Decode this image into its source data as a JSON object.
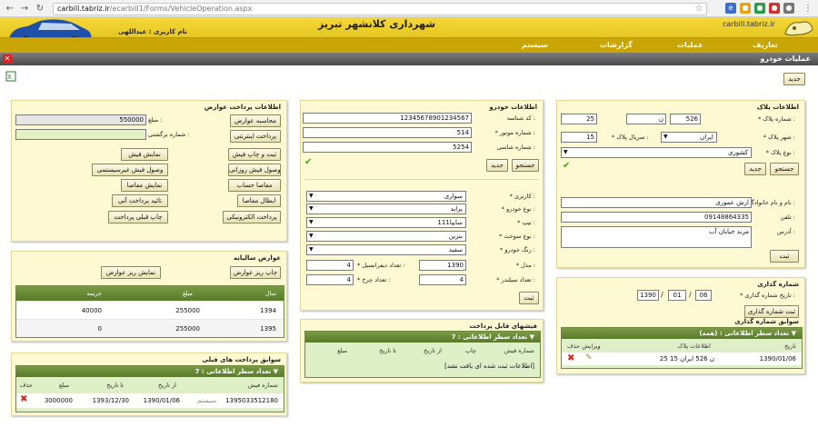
{
  "browser": {
    "host": "carbill.tabriz.ir",
    "path": "/ecarbill1/Forms/VehicleOperation.aspx"
  },
  "header": {
    "title": "شهرداری کلانشهر تبریز",
    "logo_text": "carbill.tabriz.ir",
    "user": "نام کاربری : عبداللهی"
  },
  "menu": {
    "items": [
      "تعاریف",
      "عملیات",
      "گزارشات",
      "سیستم"
    ]
  },
  "page_title": "عملیات خودرو",
  "new_button": "جدید",
  "plate": {
    "title": "اطلاعات پلاک",
    "plate_no_label": "* شماره پلاک :",
    "plate_a": "526",
    "plate_b": "ن",
    "plate_c": "25",
    "city_label": "* شهر پلاک :",
    "city": "ایران",
    "serial_label": "* سریال پلاک :",
    "serial": "15",
    "type_label": "* نوع پلاک :",
    "type": "کشوری",
    "search": "جستجو",
    "new": "جدید",
    "name_label": "* نام و نام خانوادگی :",
    "name": "ارش عموری",
    "phone_label": "تلفن :",
    "phone": "09148864335",
    "address_label": "آدرس :",
    "address": "مرند خیابان آب",
    "save": "ثبت"
  },
  "vehicle": {
    "title": "اطلاعات خودرو",
    "vin_label": "کد شناسه :",
    "vin": "12345678901234567",
    "engine_label": "* شماره موتور :",
    "engine": "514",
    "chassis_label": "شماره شاسی :",
    "chassis": "5254",
    "search": "جستجو",
    "new": "جدید",
    "usage_label": "* کاربری :",
    "usage": "سواری",
    "type_label": "* نوع خودرو :",
    "type": "پراید",
    "system_label": "* تیپ :",
    "system": "111سایپا",
    "fuel_label": "* نوع سوخت :",
    "fuel": "بنزین",
    "color_label": "* رنگ خودرو :",
    "color": "سفید",
    "model_label": "* مدل :",
    "model": "1390",
    "cyl_label": "* تعداد دیفرانسیل :",
    "cyl": "4",
    "seats_label": "* تعداد سیلندر :",
    "seats": "4",
    "wheels_label": "* تعداد چرخ :",
    "wheels": "4",
    "save": "ثبت"
  },
  "tolls": {
    "title": "اطلاعات پرداخت عوارض",
    "amount_label": "مبلغ :",
    "amount": "550000",
    "receipt_label": "شماره برگشتی :",
    "receipt": "",
    "b1": "محاسبه عوارض",
    "b2": "پرداخت اینترنتی",
    "b3": "ثبت و چاپ فیش",
    "b4": "نمایش فیش",
    "b5": "وصول فیش روزانی",
    "b6": "وصول فیش غیرسیستمی",
    "b7": "مفاصا حساب",
    "b8": "نمایش مفاصا",
    "b9": "ابطال مفاصا",
    "b10": "تائید پرداخت آنی",
    "b11": "پرداخت الکترونیکی",
    "b12": "چاپ قبلی پرداخت"
  },
  "annual": {
    "title": "عوارض سالیانه",
    "print": "چاپ ریز عوارض",
    "show": "نمایش ریز عوارض",
    "headers": [
      "سال",
      "مبلغ",
      "جریمه"
    ],
    "rows": [
      [
        "1394",
        "255000",
        "40000"
      ],
      [
        "1395",
        "255000",
        "0"
      ]
    ]
  },
  "receipts_grid": {
    "title": "فیشهای قابل پرداخت",
    "count_label": "تعداد سطر اطلاعاتی :",
    "count": "7",
    "headers": [
      "شماره فیش",
      "چاپ",
      "از تاریخ",
      "تا تاریخ",
      "مبلغ"
    ],
    "empty": "[اطلاعات ثبت شده ای یافت نشد]"
  },
  "history": {
    "title": "سوابق پرداخت های قبلی",
    "count_label": "تعداد سطر اطلاعاتی :",
    "count": "7",
    "headers": [
      "شماره فیش",
      "",
      "از تاریخ",
      "تا تاریخ",
      "مبلغ",
      "حذف"
    ],
    "row": [
      "1395033512180",
      "سیستم",
      "1390/01/06",
      "1393/12/30",
      "3000000"
    ]
  },
  "numbering": {
    "title": "شماره گذاری",
    "date_label": "* تاریخ شماره گذاری :",
    "day": "06",
    "month": "01",
    "year": "1390",
    "save": "ثبت شماره گذاری",
    "history_title": "سوابق شماره گذاری",
    "count_label": "تعداد سطر اطلاعاتی :",
    "count": "(همه)",
    "headers": [
      "تاریخ",
      "اطلاعات پلاک",
      "ویرایش حذف"
    ],
    "row": [
      "1390/01/06",
      "25 ن 526 ایران 15"
    ]
  },
  "colors": {
    "gold": "#d9b80c",
    "panel": "#fdf9d2",
    "grid_head": "#587a2a"
  }
}
